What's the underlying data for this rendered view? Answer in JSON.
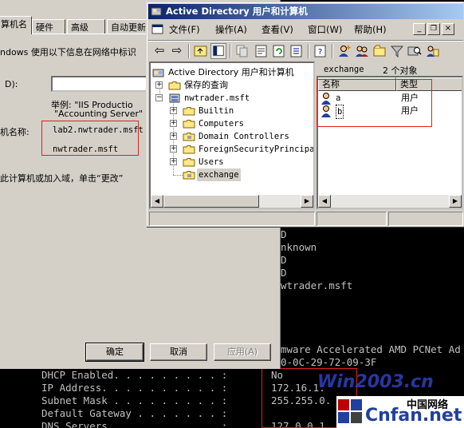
{
  "console": {
    "lines_right": [
      "D",
      "nknown",
      "D",
      "D",
      "wtrader.msft",
      "mware Accelerated AMD PCNet Ad",
      "0-0C-29-72-09-3F"
    ],
    "lines_bottom": [
      {
        "label": "DHCP Enabled. . . . . . . . . : ",
        "value": "No"
      },
      {
        "label": "IP Address. . . . . . . . . . : ",
        "value": "172.16.1."
      },
      {
        "label": "Subnet Mask . . . . . . . . . : ",
        "value": "255.255.0."
      },
      {
        "label": "Default Gateway . . . . . . . : ",
        "value": ""
      },
      {
        "label": "DNS Servers . . . . . . . . . : ",
        "value": "127.0.0.1"
      }
    ]
  },
  "system_dialog": {
    "tabs": [
      "算机名",
      "硬件",
      "高级",
      "自动更新"
    ],
    "intro_text": "ndows 使用以下信息在网络中标识",
    "description_label": "D):",
    "example_line1": "举例: \"IIS Productio",
    "example_line2": "\"Accounting Server\"",
    "full_name_label": "机名称:",
    "full_name_value": "lab2.nwtrader.msft",
    "domain_value": "nwtrader.msft",
    "change_text": "此计算机或加入域，单击“更改”",
    "ok_button": "确定",
    "cancel_button": "取消",
    "apply_button": "应用(A)"
  },
  "ad_window": {
    "title": "Active Directory 用户和计算机",
    "menu": [
      "文件(F)",
      "操作(A)",
      "查看(V)",
      "窗口(W)",
      "帮助(H)"
    ],
    "tree": {
      "root": "Active Directory 用户和计算机",
      "saved_queries": "保存的查询",
      "domain": "nwtrader.msft",
      "children": [
        "Builtin",
        "Computers",
        "Domain Controllers",
        "ForeignSecurityPrincipa",
        "Users",
        "exchange"
      ]
    },
    "list_title": "exchange",
    "object_count": "2 个对象",
    "columns": [
      "名称",
      "类型"
    ],
    "rows": [
      {
        "name": "a",
        "type": "用户"
      },
      {
        "name": "b",
        "type": "用户"
      }
    ]
  },
  "watermark": {
    "site_text": "Win2003.cn",
    "brand_cn": "中国网络",
    "brand_en": "Cnfan.net"
  },
  "colors": {
    "title_gradient_start": "#0a246a",
    "title_gradient_end": "#a6caf0",
    "annotation_red": "#e02020",
    "window_face": "#d4d0c8"
  }
}
